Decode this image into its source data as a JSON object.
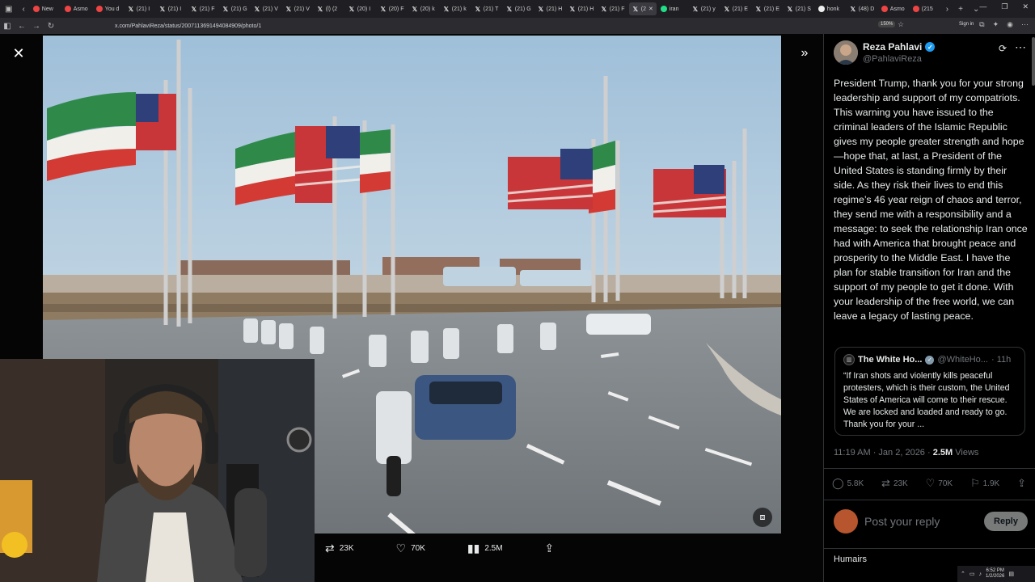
{
  "browser": {
    "tabs": [
      {
        "label": "New",
        "fav": "red"
      },
      {
        "label": "Asmo",
        "fav": "red"
      },
      {
        "label": "You d",
        "fav": "red"
      },
      {
        "label": "(21) I",
        "fav": "x"
      },
      {
        "label": "(21) I",
        "fav": "x"
      },
      {
        "label": "(21) F",
        "fav": "x"
      },
      {
        "label": "(21) G",
        "fav": "x"
      },
      {
        "label": "(21) V",
        "fav": "x"
      },
      {
        "label": "(21) V",
        "fav": "x"
      },
      {
        "label": "(l) (2",
        "fav": "x"
      },
      {
        "label": "(20) I",
        "fav": "x"
      },
      {
        "label": "(20) F",
        "fav": "x"
      },
      {
        "label": "(20) k",
        "fav": "x"
      },
      {
        "label": "(21) k",
        "fav": "x"
      },
      {
        "label": "(21) T",
        "fav": "x"
      },
      {
        "label": "(21) G",
        "fav": "x"
      },
      {
        "label": "(21) H",
        "fav": "x"
      },
      {
        "label": "(21) H",
        "fav": "x"
      },
      {
        "label": "(21) F",
        "fav": "x"
      },
      {
        "label": "(2",
        "fav": "x",
        "active": true
      },
      {
        "label": "iran",
        "fav": "g"
      },
      {
        "label": "(21) y",
        "fav": "x"
      },
      {
        "label": "(21) E",
        "fav": "x"
      },
      {
        "label": "(21) E",
        "fav": "x"
      },
      {
        "label": "(21) S",
        "fav": "x"
      },
      {
        "label": "honk",
        "fav": "w"
      },
      {
        "label": "(48) D",
        "fav": "x"
      },
      {
        "label": "Asmo",
        "fav": "red"
      },
      {
        "label": "(215",
        "fav": "red"
      }
    ],
    "url": "x.com/PahlaviReza/status/2007113691494084909/photo/1",
    "zoom": "150%",
    "signin": "Sign in"
  },
  "viewer": {
    "retweets": "23K",
    "likes": "70K",
    "views": "2.5M"
  },
  "post": {
    "author_name": "Reza Pahlavi",
    "author_handle": "@PahlaviReza",
    "text": "President Trump, thank you for your strong leadership and support of my compatriots. This warning you have issued to the criminal leaders of the Islamic Republic gives my people greater strength and hope—hope that, at last, a President of the United States is standing firmly by their side. As they risk their lives to end this regime’s 46 year reign of chaos and terror, they send me with a responsibility and a message: to seek the relationship Iran once had with America that brought peace and prosperity to the Middle East. I have the plan for stable transition for Iran and the support of my people to get it done. With your leadership of the free world, we can leave a legacy of lasting peace.",
    "quote": {
      "name": "The White Ho...",
      "handle": "@WhiteHo...",
      "time": "· 11h",
      "text": "“If Iran shots and violently kills peaceful protesters, which is their custom, the United States of America will come to their rescue. We are locked and loaded and ready to go. Thank you for your ..."
    },
    "timestamp": "11:19 AM · Jan 2, 2026 ·",
    "views_count": "2.5M",
    "views_label": "Views",
    "stats": {
      "replies": "5.8K",
      "reposts": "23K",
      "likes": "70K",
      "bookmarks": "1.9K"
    },
    "reply_placeholder": "Post your reply",
    "reply_button": "Reply",
    "next_reply_name": "Humairs"
  },
  "tray": {
    "time": "6:52 PM",
    "date": "1/2/2026"
  },
  "colors": {
    "accent": "#1d9bf0",
    "background": "#000000",
    "text": "#e7e9ea",
    "muted": "#71767b"
  }
}
